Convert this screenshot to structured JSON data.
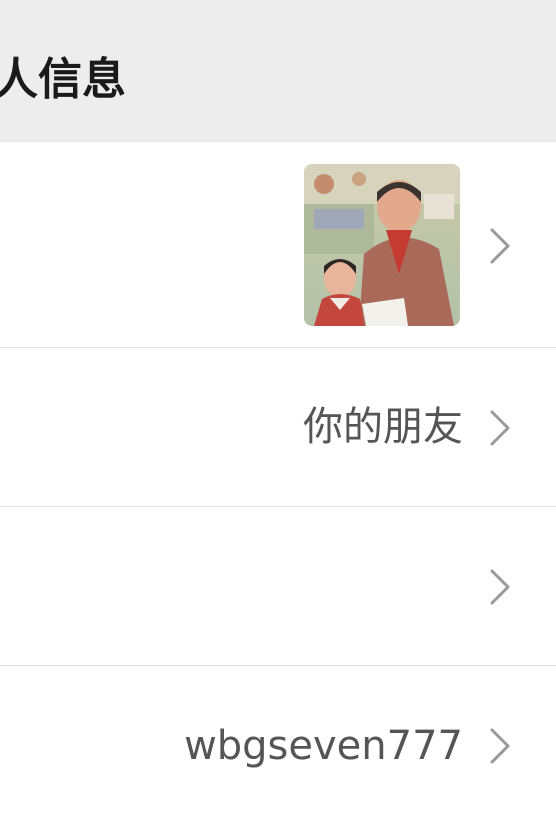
{
  "header": {
    "title": "人信息"
  },
  "rows": [
    {
      "name": "avatar",
      "value": ""
    },
    {
      "name": "nickname",
      "value": "你的朋友"
    },
    {
      "name": "blank",
      "value": ""
    },
    {
      "name": "wechat-id",
      "value": "wbgseven777"
    }
  ],
  "colors": {
    "header_bg": "#ededed",
    "divider": "#e3e3e3",
    "chevron": "#9a9a9a"
  },
  "icons": {
    "chevron": "chevron-right-icon"
  }
}
